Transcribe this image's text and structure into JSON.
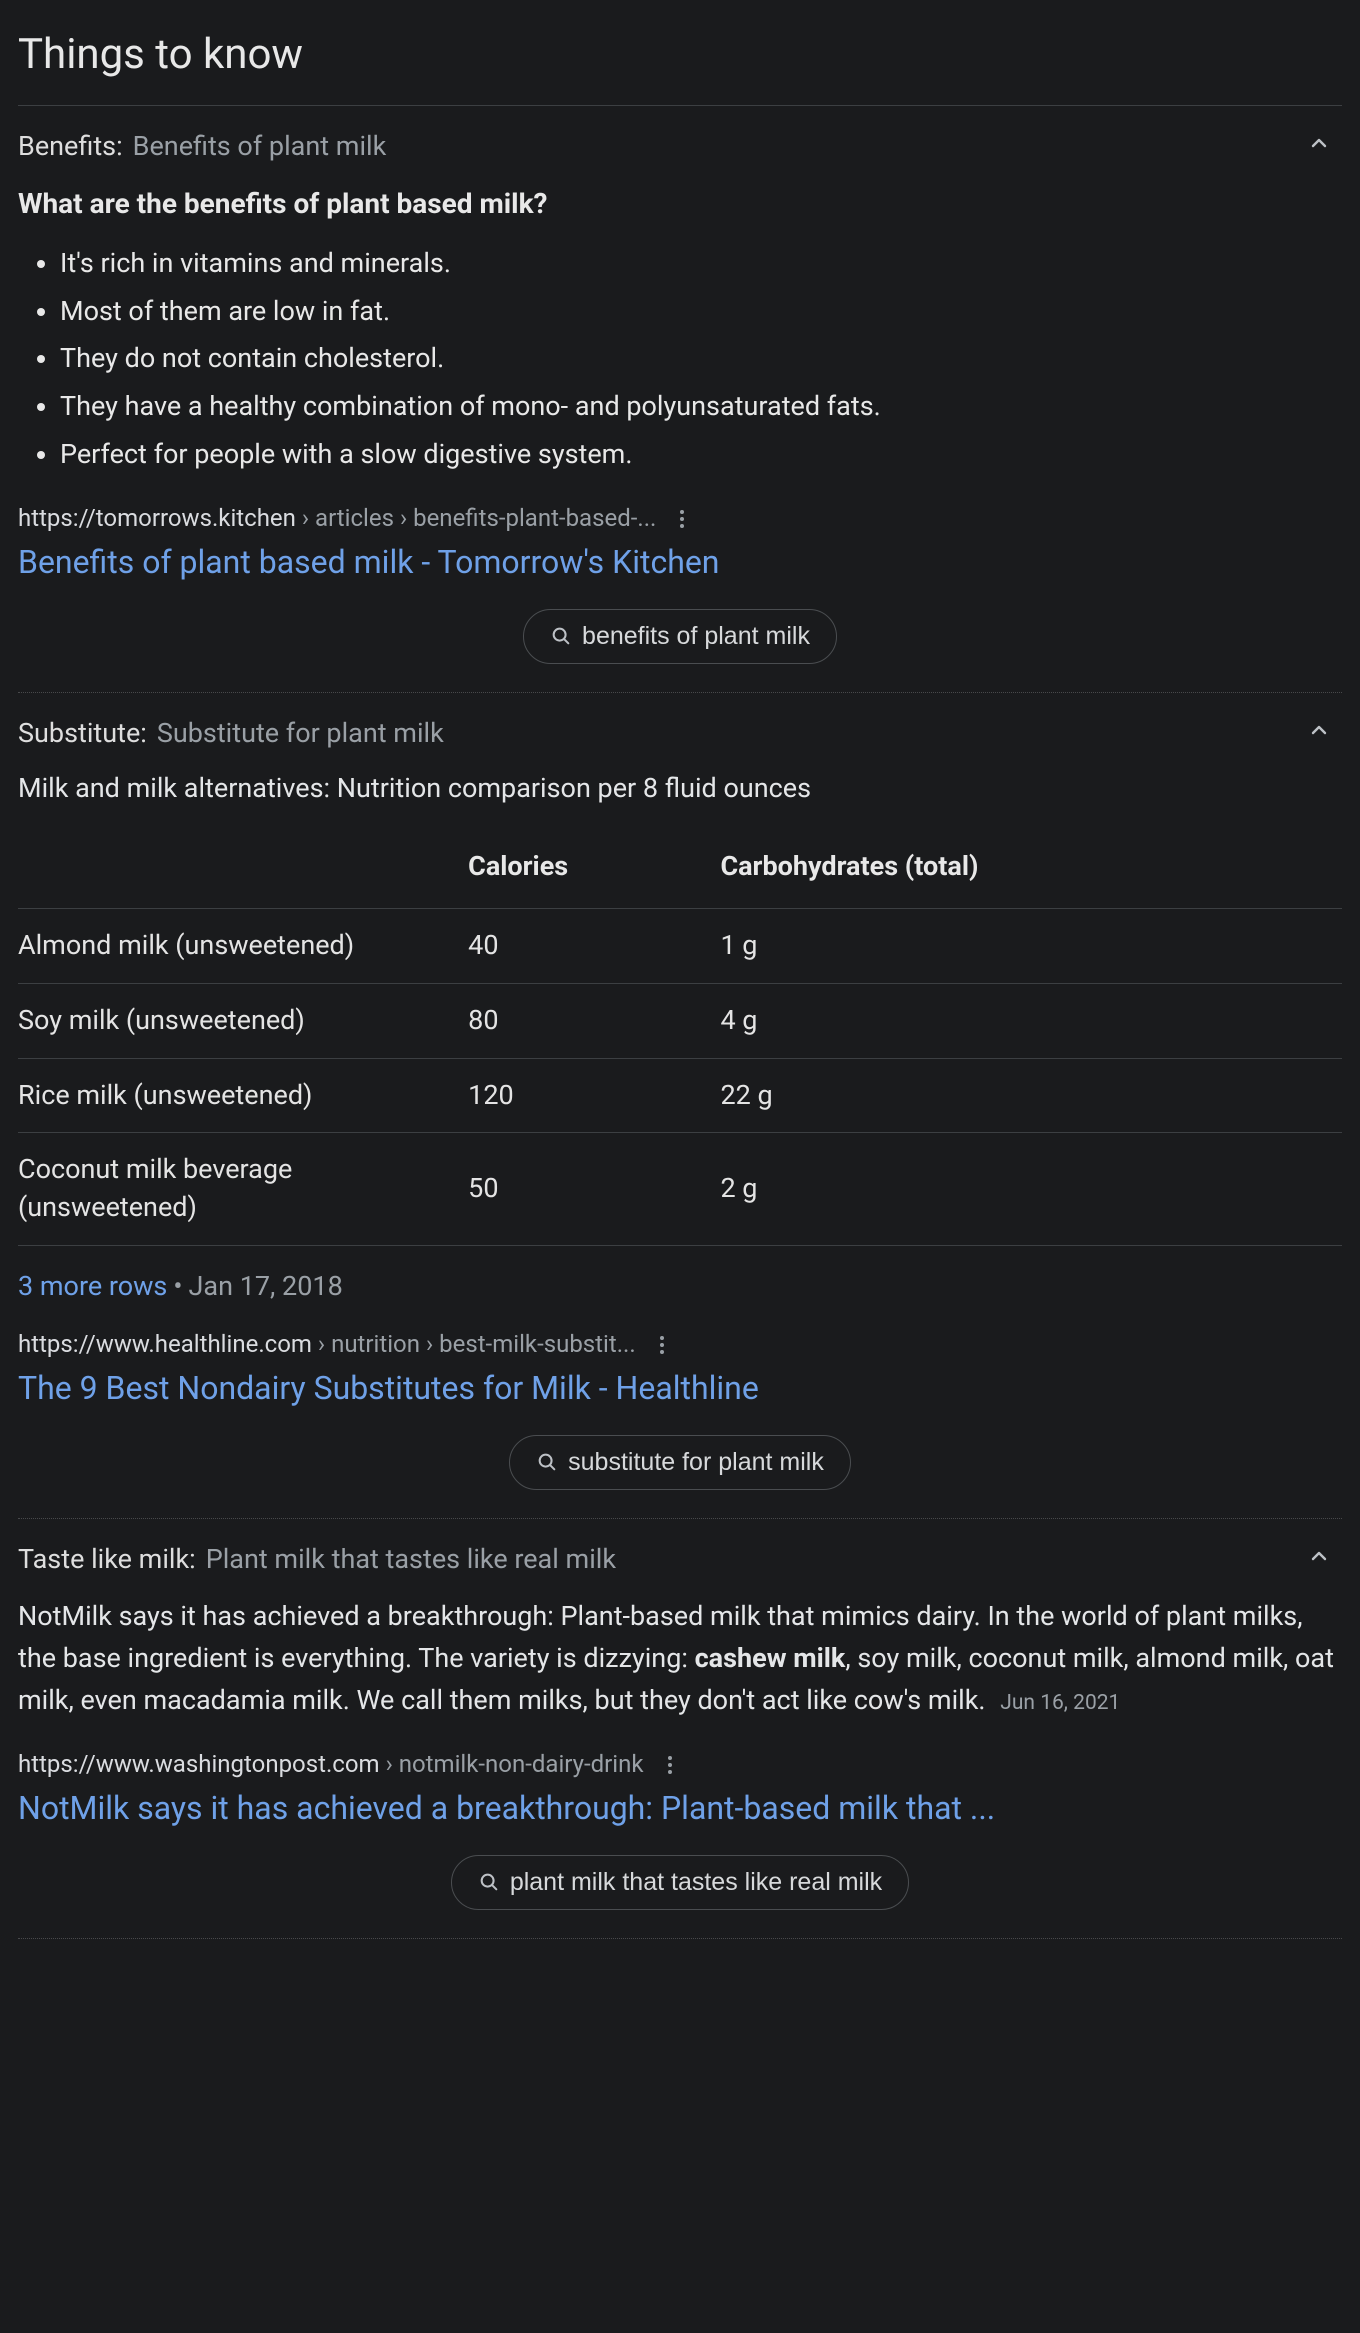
{
  "section_title": "Things to know",
  "benefits": {
    "label": "Benefits:",
    "subtitle": "Benefits of plant milk",
    "question": "What are the benefits of plant based milk?",
    "bullets": [
      "It's rich in vitamins and minerals.",
      "Most of them are low in fat.",
      "They do not contain cholesterol.",
      "They have a healthy combination of mono- and polyunsaturated fats.",
      "Perfect for people with a slow digestive system."
    ],
    "cite_host": "https://tomorrows.kitchen",
    "cite_crumbs": " › articles › benefits-plant-based-...",
    "result_title": "Benefits of plant based milk - Tomorrow's Kitchen",
    "chip": "benefits of plant milk"
  },
  "substitute": {
    "label": "Substitute:",
    "subtitle": "Substitute for plant milk",
    "intro": "Milk and milk alternatives: Nutrition comparison per 8 fluid ounces",
    "columns": [
      "",
      "Calories",
      "Carbohydrates (total)"
    ],
    "rows": [
      {
        "name": "Almond milk (unsweetened)",
        "calories": "40",
        "carbs": "1 g"
      },
      {
        "name": "Soy milk (unsweetened)",
        "calories": "80",
        "carbs": "4 g"
      },
      {
        "name": "Rice milk (unsweetened)",
        "calories": "120",
        "carbs": "22 g"
      },
      {
        "name": "Coconut milk beverage (unsweetened)",
        "calories": "50",
        "carbs": "2 g"
      }
    ],
    "more_rows": "3 more rows",
    "date": "Jan 17, 2018",
    "cite_host": "https://www.healthline.com",
    "cite_crumbs": " › nutrition › best-milk-substit...",
    "result_title": "The 9 Best Nondairy Substitutes for Milk - Healthline",
    "chip": "substitute for plant milk"
  },
  "taste": {
    "label": "Taste like milk:",
    "subtitle": "Plant milk that tastes like real milk",
    "para_pre": "NotMilk says it has achieved a breakthrough: Plant-based milk that mimics dairy. In the world of plant milks, the base ingredient is everything. The variety is dizzying: ",
    "para_bold": "cashew milk",
    "para_post": ", soy milk, coconut milk, almond milk, oat milk, even macadamia milk. We call them milks, but they don't act like cow's milk.",
    "date": "Jun 16, 2021",
    "cite_host": "https://www.washingtonpost.com",
    "cite_crumbs": " › notmilk-non-dairy-drink",
    "result_title": "NotMilk says it has achieved a breakthrough: Plant-based milk that ...",
    "chip": "plant milk that tastes like real milk"
  }
}
